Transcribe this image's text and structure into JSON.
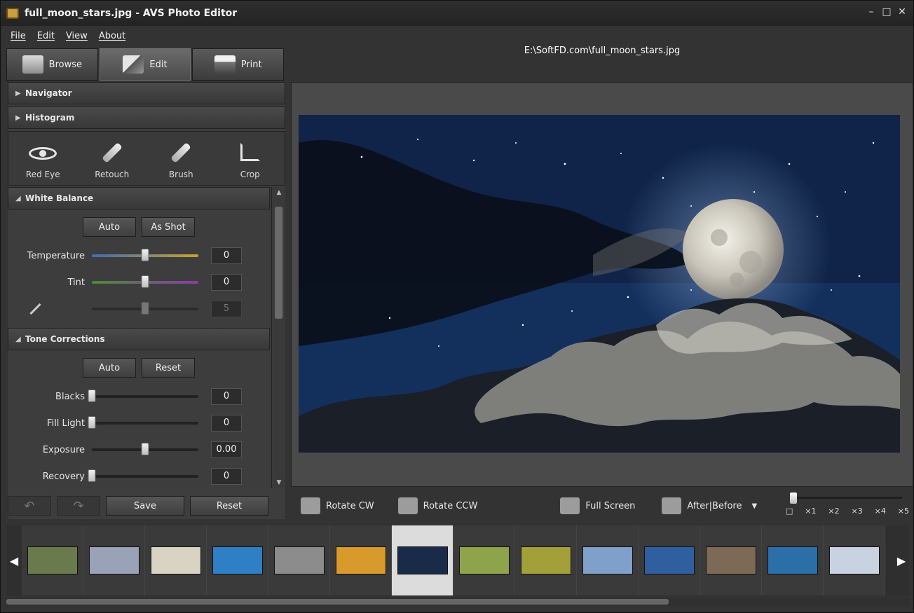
{
  "window": {
    "title": "full_moon_stars.jpg - AVS Photo Editor",
    "controls": [
      "–",
      "□",
      "✕"
    ]
  },
  "menu": [
    "File",
    "Edit",
    "View",
    "About"
  ],
  "filepath": "E:\\SoftFD.com\\full_moon_stars.jpg",
  "tabs": [
    {
      "label": "Browse",
      "icon": "browse-icon"
    },
    {
      "label": "Edit",
      "icon": "edit-icon"
    },
    {
      "label": "Print",
      "icon": "print-icon"
    }
  ],
  "panel": {
    "navigator": "Navigator",
    "histogram": "Histogram",
    "tools": [
      {
        "label": "Red Eye",
        "icon": "red-eye-icon"
      },
      {
        "label": "Retouch",
        "icon": "retouch-icon"
      },
      {
        "label": "Brush",
        "icon": "brush-icon"
      },
      {
        "label": "Crop",
        "icon": "crop-icon"
      }
    ],
    "white_balance": {
      "title": "White Balance",
      "buttons": [
        "Auto",
        "As Shot"
      ],
      "rows": [
        {
          "label": "Temperature",
          "value": "0",
          "level": 0.5
        },
        {
          "label": "Tint",
          "value": "0",
          "level": 0.5
        },
        {
          "label": "",
          "value": "5",
          "level": 0.5,
          "disabled": true
        }
      ]
    },
    "tone_corrections": {
      "title": "Tone Corrections",
      "buttons": [
        "Auto",
        "Reset"
      ],
      "rows": [
        {
          "label": "Blacks",
          "value": "0",
          "level": 0.0
        },
        {
          "label": "Fill Light",
          "value": "0",
          "level": 0.0
        },
        {
          "label": "Exposure",
          "value": "0.00",
          "level": 0.5
        },
        {
          "label": "Recovery",
          "value": "0",
          "level": 0.0
        }
      ]
    }
  },
  "bottom_buttons": {
    "save": "Save",
    "reset": "Reset"
  },
  "viewer_toolbar": {
    "rotate_cw": "Rotate CW",
    "rotate_ccw": "Rotate CCW",
    "full_screen": "Full Screen",
    "after_before": "After|Before",
    "zoom_labels": [
      "□",
      "×1",
      "×2",
      "×3",
      "×4",
      "×5"
    ]
  },
  "filmstrip": {
    "thumbs": [
      "#6a7a4c",
      "#9aa2b8",
      "#d9d3c3",
      "#2f7fc4",
      "#8c8c8c",
      "#d89b2b",
      "#1a2b4a",
      "#8ea34b",
      "#a3a03a",
      "#7fa0c8",
      "#2f5f9f",
      "#7c6a56",
      "#2b6ea8",
      "#c8d2e1"
    ],
    "selected_index": 6
  }
}
